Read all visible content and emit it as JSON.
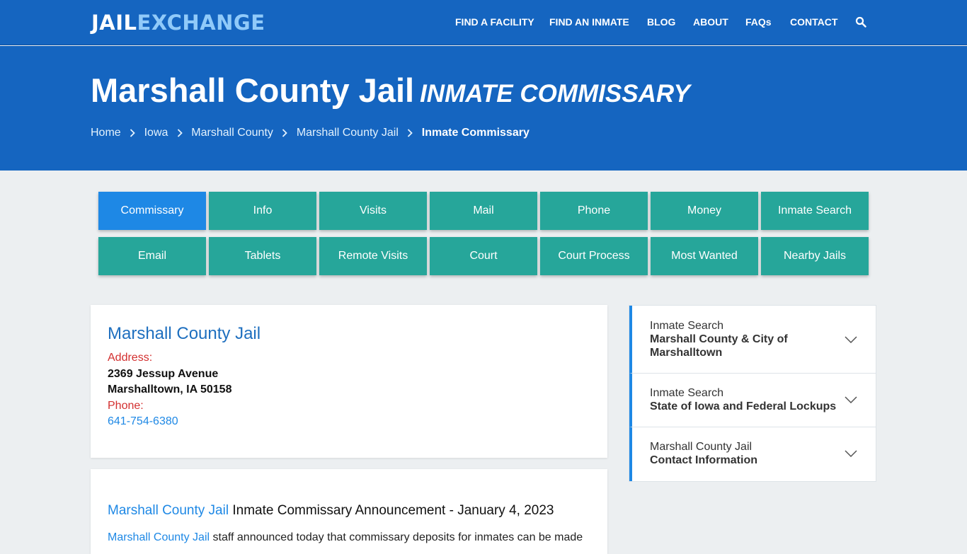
{
  "brand": {
    "part1": "JAIL",
    "part2": "EXCHANGE"
  },
  "nav": {
    "items": [
      "FIND A FACILITY",
      "FIND AN INMATE",
      "BLOG",
      "ABOUT",
      "FAQs",
      "CONTACT"
    ],
    "search_icon": "search-icon"
  },
  "hero": {
    "title": "Marshall County Jail",
    "subtitle": "INMATE COMMISSARY"
  },
  "breadcrumb": {
    "items": [
      "Home",
      "Iowa",
      "Marshall County",
      "Marshall County Jail"
    ],
    "current": "Inmate Commissary"
  },
  "tabs": {
    "row1": [
      "Commissary",
      "Info",
      "Visits",
      "Mail",
      "Phone",
      "Money",
      "Inmate Search"
    ],
    "row2": [
      "Email",
      "Tablets",
      "Remote Visits",
      "Court",
      "Court Process",
      "Most Wanted",
      "Nearby Jails"
    ],
    "active": "Commissary"
  },
  "facility": {
    "name": "Marshall County Jail",
    "address_label": "Address:",
    "address_line1": "2369 Jessup Avenue",
    "address_line2": "Marshalltown, IA 50158",
    "phone_label": "Phone:",
    "phone": "641-754-6380"
  },
  "announcement": {
    "link_text": "Marshall County Jail",
    "heading_rest": "Inmate Commissary Announcement - January 4, 2023",
    "body_link": "Marshall County Jail",
    "body_rest": "staff announced today that commissary deposits for inmates can be made"
  },
  "sidebar": {
    "items": [
      {
        "line1": "Inmate Search",
        "line2": "Marshall County & City of",
        "line3": "Marshalltown"
      },
      {
        "line1": "Inmate Search",
        "line2": "State of Iowa and Federal Lockups"
      },
      {
        "line1": "Marshall County Jail",
        "line2": "Contact Information"
      }
    ]
  },
  "colors": {
    "header_blue": "#1565c0",
    "tab_teal": "#26a69a",
    "tab_active": "#1e88e5",
    "accent_red": "#d32f2f"
  }
}
